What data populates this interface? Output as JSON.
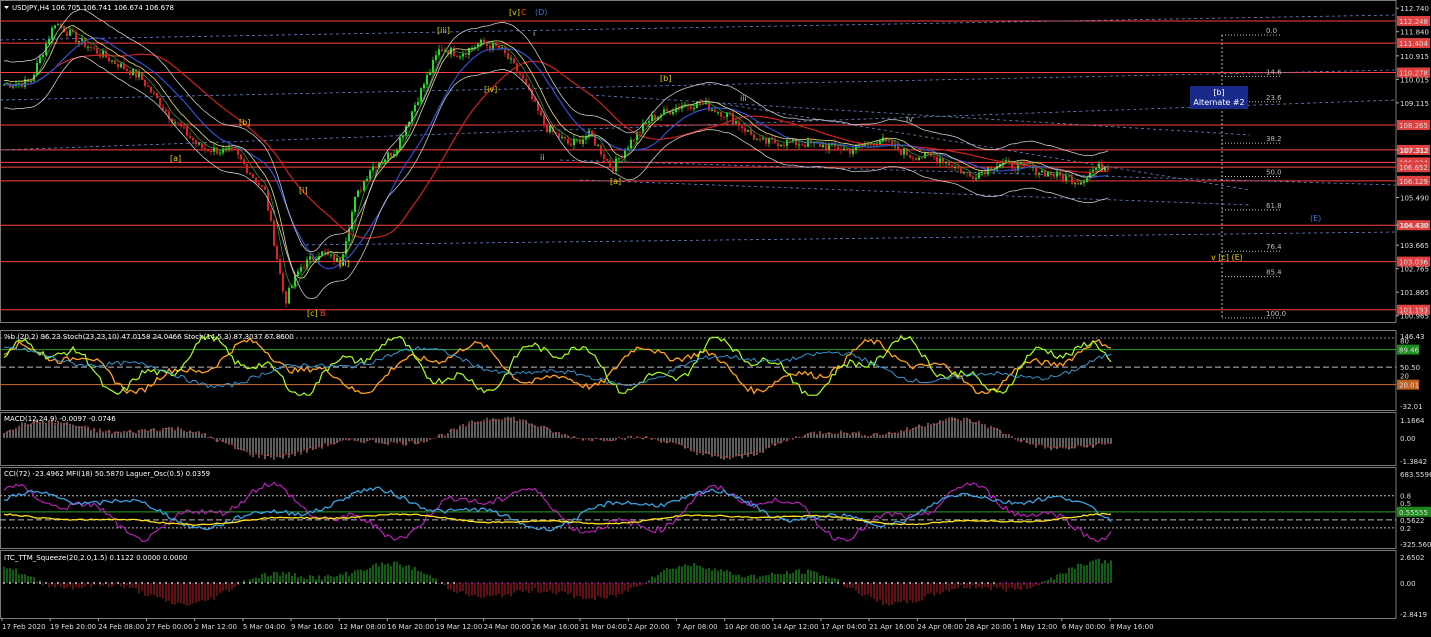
{
  "header": {
    "symbol_label": "USDJPY,H4  106.705 106.741 106.674 106.678"
  },
  "main_pane": {
    "price_axis": [
      "112.740",
      "111.840",
      "110.915",
      "110.015",
      "109.115",
      "107.312",
      "105.490",
      "104.430",
      "103.665",
      "102.765",
      "101.865",
      "100.965"
    ],
    "hlines": [
      {
        "price": "112.248",
        "color": "#ff4040"
      },
      {
        "price": "111.404",
        "color": "#ff4040"
      },
      {
        "price": "110.278",
        "color": "#ff4040"
      },
      {
        "price": "108.265",
        "color": "#ff4040"
      },
      {
        "price": "107.312",
        "color": "#ff4040"
      },
      {
        "price": "106.834",
        "color": "#ff4040"
      },
      {
        "price": "106.652",
        "color": "#ff4040"
      },
      {
        "price": "106.129",
        "color": "#ff4040"
      },
      {
        "price": "104.430",
        "color": "#ff4040"
      },
      {
        "price": "103.036",
        "color": "#ff4040"
      },
      {
        "price": "101.193",
        "color": "#ff4040"
      }
    ],
    "fib_levels": [
      "0.0",
      "14.6",
      "23.6",
      "38.2",
      "50.0",
      "61.8",
      "76.4",
      "85.4",
      "100.0"
    ],
    "wave_labels": [
      {
        "text": "[v]",
        "color": "#e6d200"
      },
      {
        "text": "C",
        "color": "#ff4040"
      },
      {
        "text": "(D)",
        "color": "#3a7bd5"
      },
      {
        "text": "[iii]",
        "color": "#e6d200"
      },
      {
        "text": "[b]",
        "color": "#e6d200"
      },
      {
        "text": "[a]",
        "color": "#e6d200"
      },
      {
        "text": "[iv]",
        "color": "#e6d200"
      },
      {
        "text": "[i]",
        "color": "#e6d200"
      },
      {
        "text": "[ii]",
        "color": "#e6d200"
      },
      {
        "text": "[c]",
        "color": "#e6d200"
      },
      {
        "text": "B",
        "color": "#ff4040"
      },
      {
        "text": "[a]",
        "color": "#e6d200"
      },
      {
        "text": "[b]",
        "color": "#e6d200"
      },
      {
        "text": "(E)",
        "color": "#3a7bd5"
      },
      {
        "text": "v [c] (E)",
        "color": "#e6d200"
      },
      {
        "text": "ii",
        "color": "#9fd7a0"
      },
      {
        "text": "iii",
        "color": "#9fd7a0"
      },
      {
        "text": "iv",
        "color": "#9fd7a0"
      },
      {
        "text": "i",
        "color": "#9fd7a0"
      }
    ],
    "annotation_box": {
      "line1": "[b]",
      "line2": "Alternate #2"
    }
  },
  "stoch_pane": {
    "title": "%b (20,2) 96.23  Stoch(23,23,10) 47.0158 24.0466  Stoch(14,5,3) 87.3037 67.8600",
    "axis": [
      "146.43",
      "80",
      "50.50",
      "20",
      "-32.01"
    ],
    "highlight": "89.46",
    "highlight2": "20.01"
  },
  "macd_pane": {
    "title": "MACD(12,24,9) -0.0097 -0.0746",
    "axis": [
      "1.1664",
      "0.00",
      "-1.3842"
    ]
  },
  "cci_pane": {
    "title": "CCI(72) -23.4962  MFI(18) 50.5870  Laguer_Osc(0.5) 0.0359",
    "axis": [
      "683.5596",
      "0.8",
      "0.5",
      "0.5622",
      "0.2",
      "-325.5602"
    ],
    "highlight": "0.55555"
  },
  "ttm_pane": {
    "title": "ITC_TTM_Squeeze(20,2.0,1.5) 0.1122 0.0000 0.0000",
    "axis": [
      "2.6502",
      "0.00",
      "-2.8419"
    ]
  },
  "time_axis": [
    "17 Feb 2020",
    "19 Feb 20:00",
    "24 Feb 08:00",
    "27 Feb 00:00",
    "2 Mar 12:00",
    "5 Mar 04:00",
    "9 Mar 16:00",
    "12 Mar 08:00",
    "16 Mar 20:00",
    "19 Mar 12:00",
    "24 Mar 00:00",
    "26 Mar 16:00",
    "31 Mar 04:00",
    "2 Apr 20:00",
    "7 Apr 08:00",
    "10 Apr 00:00",
    "14 Apr 12:00",
    "17 Apr 04:00",
    "21 Apr 16:00",
    "24 Apr 08:00",
    "28 Apr 20:00",
    "1 May 12:00",
    "6 May 00:00",
    "8 May 16:00"
  ],
  "colors": {
    "background": "#000000",
    "grid": "#3a3a3a",
    "level": "#ff4040",
    "bull": "#22dd22",
    "bear": "#dd2222"
  }
}
